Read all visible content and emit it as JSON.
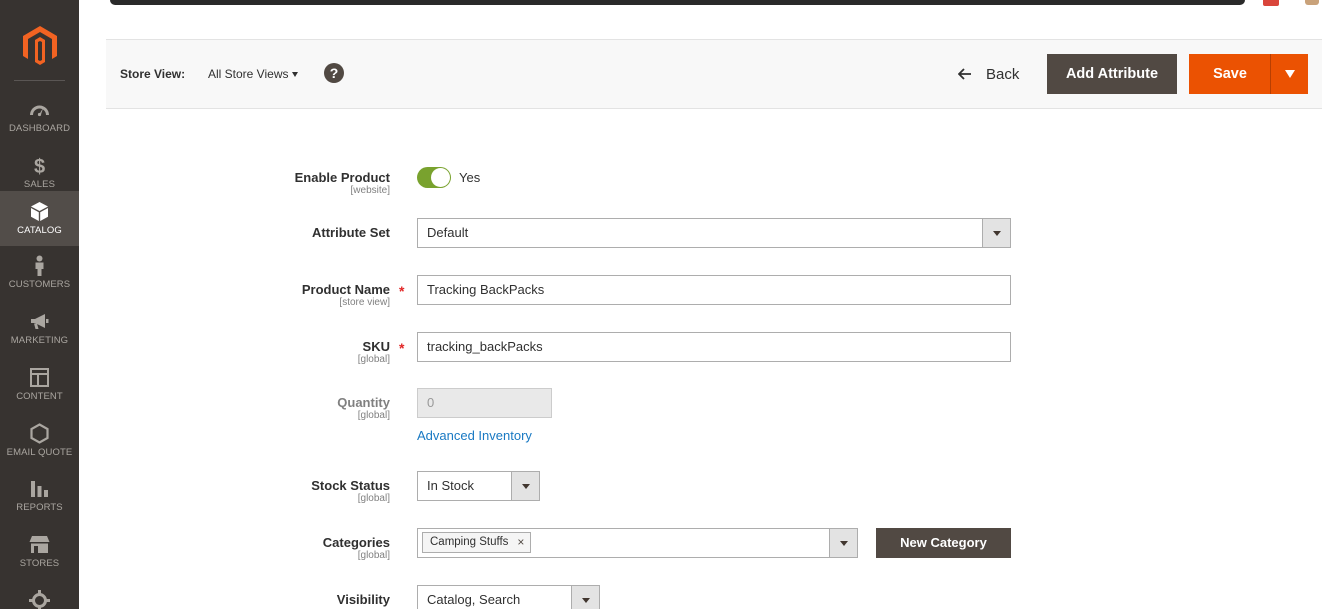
{
  "sidebar": {
    "items": [
      {
        "label": "DASHBOARD",
        "icon": "dashboard-icon"
      },
      {
        "label": "SALES",
        "icon": "dollar-icon"
      },
      {
        "label": "CATALOG",
        "icon": "cube-icon",
        "active": true
      },
      {
        "label": "CUSTOMERS",
        "icon": "person-icon"
      },
      {
        "label": "MARKETING",
        "icon": "megaphone-icon"
      },
      {
        "label": "CONTENT",
        "icon": "layout-icon"
      },
      {
        "label": "EMAIL QUOTE",
        "icon": "hexagon-icon"
      },
      {
        "label": "REPORTS",
        "icon": "bar-chart-icon"
      },
      {
        "label": "STORES",
        "icon": "store-icon"
      },
      {
        "label": "",
        "icon": "gear-icon"
      }
    ]
  },
  "toolbar": {
    "store_view_label": "Store View:",
    "store_view_value": "All Store Views",
    "help": "?",
    "back_label": "Back",
    "add_attribute_label": "Add Attribute",
    "save_label": "Save"
  },
  "form": {
    "enable_product": {
      "label": "Enable Product",
      "scope": "[website]",
      "value": "Yes"
    },
    "attribute_set": {
      "label": "Attribute Set",
      "value": "Default"
    },
    "product_name": {
      "label": "Product Name",
      "scope": "[store view]",
      "value": "Tracking BackPacks",
      "required": "*"
    },
    "sku": {
      "label": "SKU",
      "scope": "[global]",
      "value": "tracking_backPacks",
      "required": "*"
    },
    "quantity": {
      "label": "Quantity",
      "scope": "[global]",
      "value": "0",
      "link": "Advanced Inventory"
    },
    "stock_status": {
      "label": "Stock Status",
      "scope": "[global]",
      "value": "In Stock"
    },
    "categories": {
      "label": "Categories",
      "scope": "[global]",
      "chip": "Camping Stuffs",
      "chip_remove": "×",
      "new_button": "New Category"
    },
    "visibility": {
      "label": "Visibility",
      "value": "Catalog, Search"
    }
  },
  "colors": {
    "sidebar_bg": "#373330",
    "accent_orange": "#eb5202",
    "dark_button": "#514943",
    "toggle_on": "#79a22e",
    "link": "#1979c3"
  }
}
